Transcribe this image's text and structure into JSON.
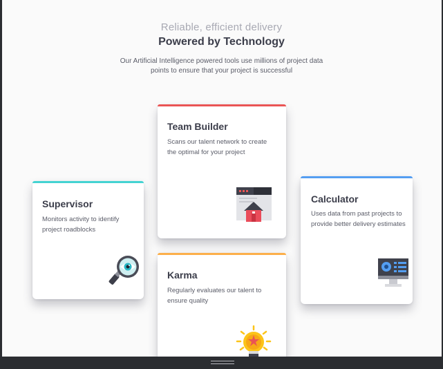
{
  "header": {
    "tagline": "Reliable, efficient delivery",
    "title": "Powered by Technology",
    "intro": "Our Artificial Intelligence powered tools use millions of project data points to ensure that your project is successful"
  },
  "cards": {
    "supervisor": {
      "title": "Supervisor",
      "description": "Monitors activity to identify project roadblocks",
      "accent": "#44d3d2",
      "icon": "magnifier-eye-icon"
    },
    "team_builder": {
      "title": "Team Builder",
      "description": "Scans our talent network to create the optimal for your project",
      "accent": "#ea5454",
      "icon": "team-builder-window-icon"
    },
    "calculator": {
      "title": "Calculator",
      "description": "Uses data from past projects to provide better delivery estimates",
      "accent": "#549ef2",
      "icon": "calculator-monitor-icon"
    },
    "karma": {
      "title": "Karma",
      "description": "Regularly evaluates our talent to ensure quality",
      "accent": "#fcaf4a",
      "icon": "lightbulb-icon"
    }
  }
}
